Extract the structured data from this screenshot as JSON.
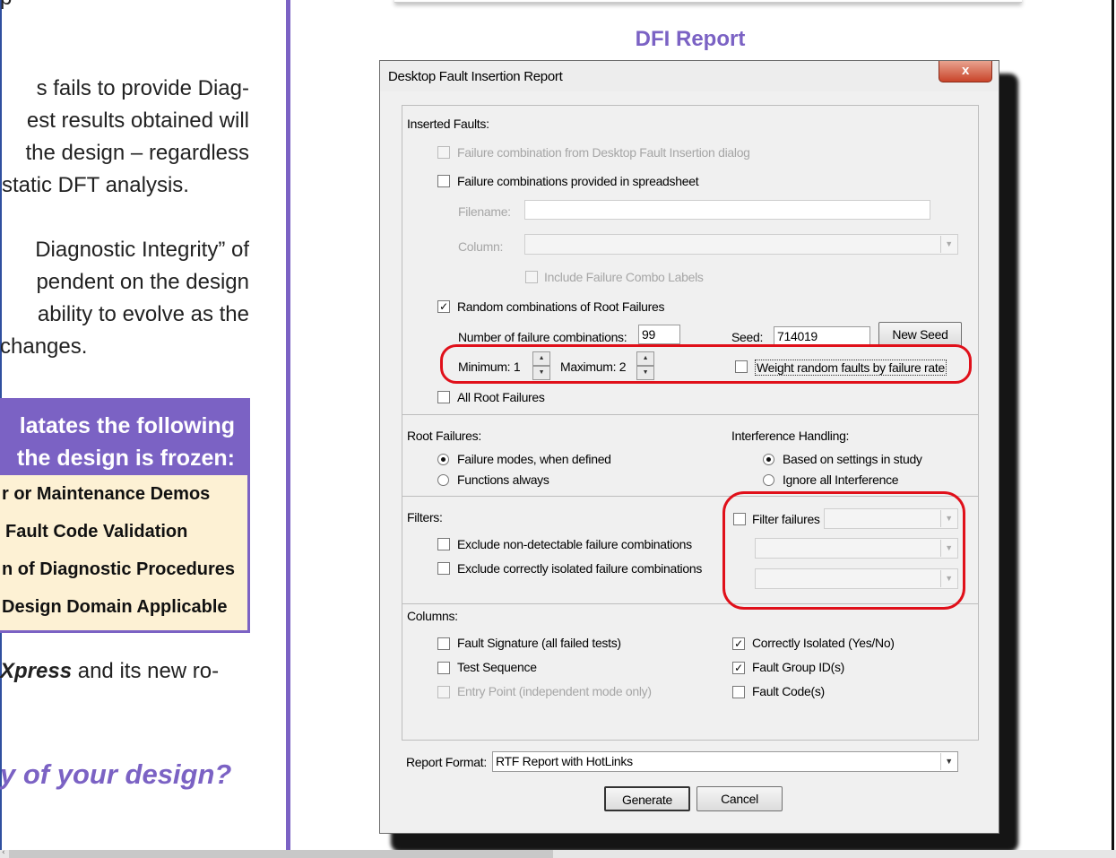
{
  "left_column": {
    "top_fragment": "p",
    "paragraph1": [
      "s fails to provide Diag-",
      "est results obtained will",
      "the design – regardless",
      "static DFT analysis."
    ],
    "paragraph2": [
      "Diagnostic Integrity” of",
      "pendent on the design",
      "ability to evolve as the",
      "changes."
    ],
    "callout": {
      "heading": [
        "latates the following",
        "the design is frozen:"
      ],
      "items": [
        "r or Maintenance Demos",
        "Fault Code Validation",
        "n of Diagnostic Procedures",
        "Design Domain Applicable"
      ]
    },
    "xpress_bold": "Xpress",
    "xpress_rest": " and its new ro-",
    "question": "y of your design?"
  },
  "figure_title": "DFI Report",
  "dialog": {
    "title": "Desktop Fault Insertion Report",
    "close_glyph": "x",
    "inserted_faults": {
      "heading": "Inserted Faults:",
      "opt_from_dialog": "Failure combination from Desktop Fault Insertion dialog",
      "opt_spreadsheet": "Failure combinations provided in spreadsheet",
      "filename_label": "Filename:",
      "column_label": "Column:",
      "include_labels": "Include Failure Combo Labels",
      "opt_random": "Random combinations of Root Failures",
      "num_combos_label": "Number of failure combinations:",
      "num_combos_value": "99",
      "seed_label": "Seed:",
      "seed_value": "714019",
      "new_seed_button": "New Seed",
      "min_label": "Minimum: 1",
      "max_label": "Maximum: 2",
      "weight_label": "Weight random faults by failure rate",
      "opt_all_root": "All Root Failures"
    },
    "root_failures": {
      "heading": "Root Failures:",
      "opt_failure_modes": "Failure modes, when defined",
      "opt_functions": "Functions always"
    },
    "interference": {
      "heading": "Interference Handling:",
      "opt_study": "Based on settings in study",
      "opt_ignore": "Ignore all Interference"
    },
    "filters": {
      "heading": "Filters:",
      "opt_non_detectable": "Exclude non-detectable failure combinations",
      "opt_isolated": "Exclude correctly isolated failure combinations",
      "filter_failures": "Filter failures"
    },
    "columns": {
      "heading": "Columns:",
      "fault_signature": "Fault Signature (all failed tests)",
      "test_sequence": "Test Sequence",
      "entry_point": "Entry Point (independent mode only)",
      "correctly_isolated": "Correctly Isolated (Yes/No)",
      "fault_group": "Fault Group ID(s)",
      "fault_codes": "Fault Code(s)"
    },
    "report_format_label": "Report Format:",
    "report_format_value": "RTF Report with HotLinks",
    "generate_button": "Generate",
    "cancel_button": "Cancel",
    "checkmark": "✓",
    "dropdown_arrow": "▼",
    "spin_up": "▲",
    "spin_down": "▼"
  },
  "colors": {
    "accent_purple": "#7b62c4",
    "highlight_red": "#e0101a",
    "callout_fill": "#fdf1d4"
  }
}
